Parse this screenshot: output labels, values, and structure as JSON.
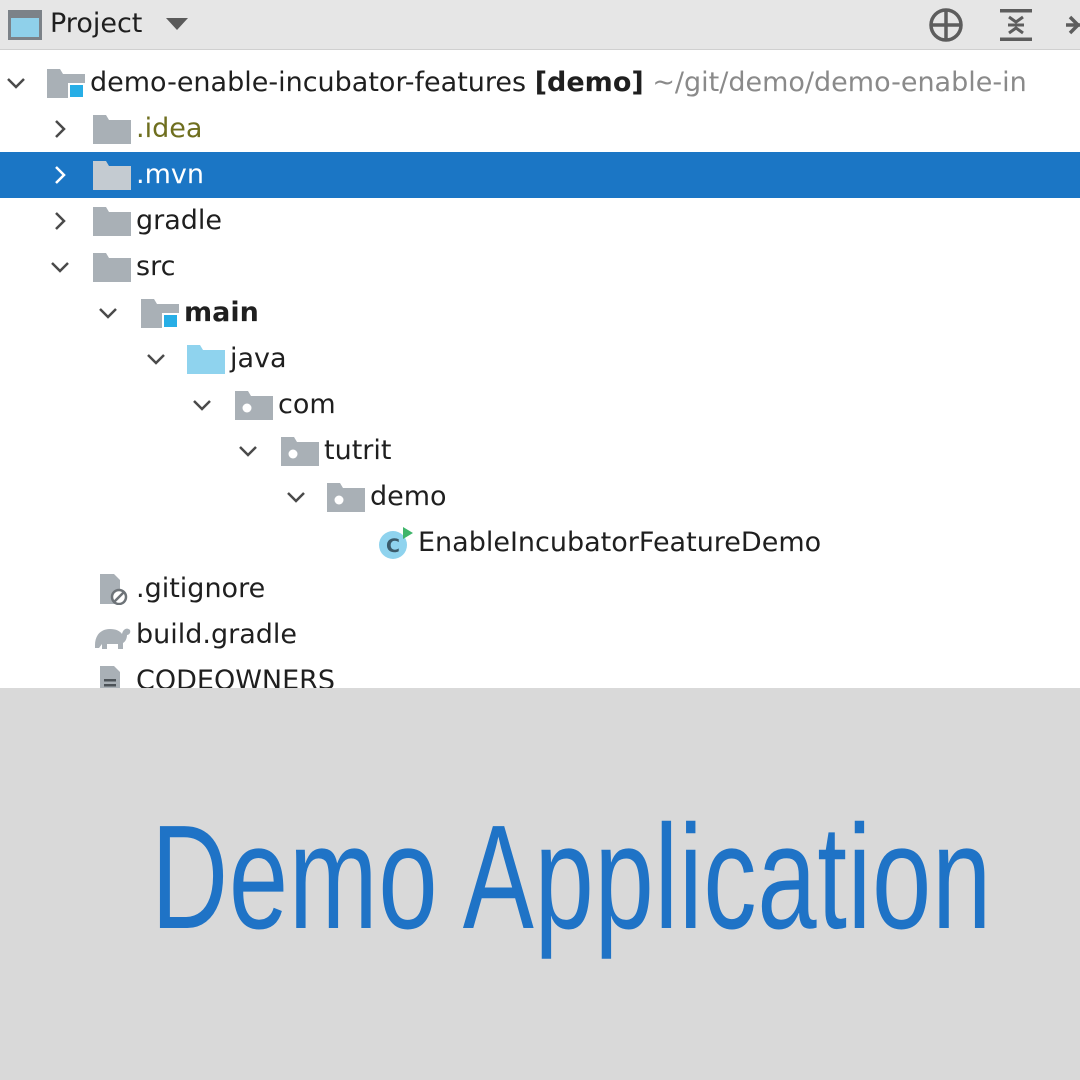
{
  "header": {
    "title": "Project",
    "title_icon": "project-window-icon",
    "buttons": [
      {
        "icon": "locate-crosshair-icon"
      },
      {
        "icon": "collapse-all-icon"
      },
      {
        "icon": "expand-icon"
      }
    ]
  },
  "tree": {
    "root": {
      "name": "demo-enable-incubator-features",
      "module": "[demo]",
      "path": "~/git/demo/demo-enable-in"
    },
    "items": [
      {
        "label": ".idea",
        "icon": "folder-icon"
      },
      {
        "label": ".mvn",
        "icon": "folder-icon",
        "selected": true
      },
      {
        "label": "gradle",
        "icon": "folder-icon"
      },
      {
        "label": "src",
        "icon": "folder-icon"
      },
      {
        "label": "main",
        "icon": "module-folder-icon"
      },
      {
        "label": "java",
        "icon": "source-root-folder-icon"
      },
      {
        "label": "com",
        "icon": "package-icon"
      },
      {
        "label": "tutrit",
        "icon": "package-icon"
      },
      {
        "label": "demo",
        "icon": "package-icon"
      },
      {
        "label": "EnableIncubatorFeatureDemo",
        "icon": "java-class-runnable-icon"
      },
      {
        "label": ".gitignore",
        "icon": "ignore-file-icon"
      },
      {
        "label": "build.gradle",
        "icon": "gradle-elephant-icon"
      },
      {
        "label": "CODEOWNERS",
        "icon": "text-file-icon"
      }
    ]
  },
  "banner": {
    "title": "Demo Application"
  },
  "colors": {
    "selection": "#1b76c5",
    "banner_bg": "#d9d9d9",
    "banner_text": "#1f73c6",
    "folder": "#a9b0b6",
    "source_root": "#8fd3ee",
    "module_badge": "#27aee6"
  }
}
